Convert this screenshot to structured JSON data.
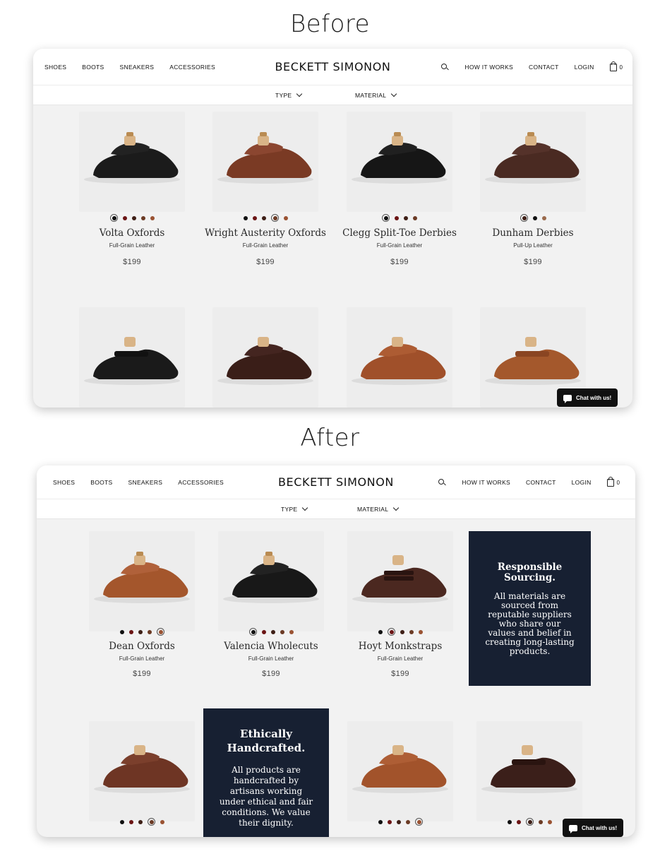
{
  "headings": {
    "before": "Before",
    "after": "After"
  },
  "nav": {
    "left": [
      "SHOES",
      "BOOTS",
      "SNEAKERS",
      "ACCESSORIES"
    ],
    "brand": "BECKETT SIMONON",
    "right": [
      "HOW IT WORKS",
      "CONTACT",
      "LOGIN"
    ],
    "cart_count": "0"
  },
  "filters": {
    "type": "TYPE",
    "material": "MATERIAL"
  },
  "chat_label": "Chat with us!",
  "colors": {
    "accent": "#172032",
    "swatch_black": "#111111",
    "swatch_oxblood": "#6b1414",
    "swatch_darkbrown": "#3e1f16",
    "swatch_brown": "#6b3a24",
    "swatch_tan": "#9a5232"
  },
  "before": {
    "products": [
      {
        "name": "Volta Oxfords",
        "material": "Full-Grain Leather",
        "price": "$199"
      },
      {
        "name": "Wright Austerity Oxfords",
        "material": "Full-Grain Leather",
        "price": "$199"
      },
      {
        "name": "Clegg Split-Toe Derbies",
        "material": "Full-Grain Leather",
        "price": "$199"
      },
      {
        "name": "Dunham Derbies",
        "material": "Pull-Up Leather",
        "price": "$199"
      }
    ]
  },
  "after": {
    "products": [
      {
        "name": "Dean Oxfords",
        "material": "Full-Grain Leather",
        "price": "$199"
      },
      {
        "name": "Valencia Wholecuts",
        "material": "Full-Grain Leather",
        "price": "$199"
      },
      {
        "name": "Hoyt Monkstraps",
        "material": "Full-Grain Leather",
        "price": "$199"
      }
    ],
    "promos": [
      {
        "title": "Responsible Sourcing.",
        "body": "All materials are sourced from reputable suppliers who share our values and belief in creating long-lasting products."
      },
      {
        "title": "Ethically Handcrafted.",
        "body": "All products are handcrafted by artisans working under ethical and fair conditions. We value their dignity."
      }
    ]
  }
}
